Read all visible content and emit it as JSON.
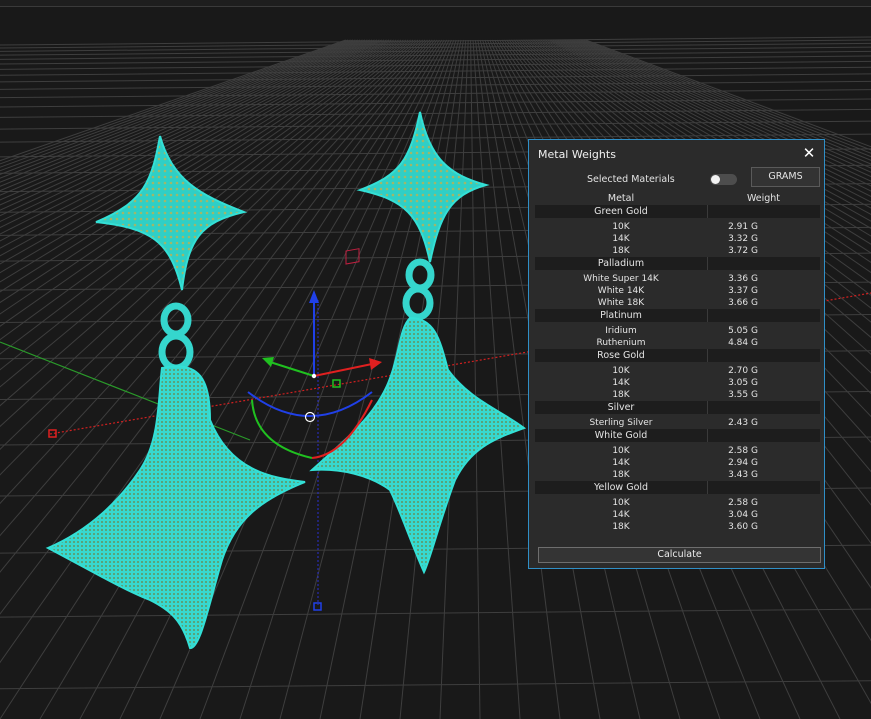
{
  "panel": {
    "title": "Metal Weights",
    "close_icon": "close-icon",
    "selected_materials_label": "Selected Materials",
    "selected_materials_on": false,
    "units_label": "GRAMS",
    "col_metal": "Metal",
    "col_weight": "Weight",
    "calculate_label": "Calculate",
    "accent_color": "#2f8fc7",
    "groups": [
      {
        "name": "Green Gold",
        "items": [
          {
            "name": "10K",
            "weight": "2.91 G"
          },
          {
            "name": "14K",
            "weight": "3.32 G"
          },
          {
            "name": "18K",
            "weight": "3.72 G"
          }
        ]
      },
      {
        "name": "Palladium",
        "items": [
          {
            "name": "White Super 14K",
            "weight": "3.36 G"
          },
          {
            "name": "White 14K",
            "weight": "3.37 G"
          },
          {
            "name": "White 18K",
            "weight": "3.66 G"
          }
        ]
      },
      {
        "name": "Platinum",
        "items": [
          {
            "name": "Iridium",
            "weight": "5.05 G"
          },
          {
            "name": "Ruthenium",
            "weight": "4.84 G"
          }
        ]
      },
      {
        "name": "Rose Gold",
        "items": [
          {
            "name": "10K",
            "weight": "2.70 G"
          },
          {
            "name": "14K",
            "weight": "3.05 G"
          },
          {
            "name": "18K",
            "weight": "3.55 G"
          }
        ]
      },
      {
        "name": "Silver",
        "items": [
          {
            "name": "Sterling Silver",
            "weight": "2.43 G"
          }
        ]
      },
      {
        "name": "White Gold",
        "items": [
          {
            "name": "10K",
            "weight": "2.58 G"
          },
          {
            "name": "14K",
            "weight": "2.94 G"
          },
          {
            "name": "18K",
            "weight": "3.43 G"
          }
        ]
      },
      {
        "name": "Yellow Gold",
        "items": [
          {
            "name": "10K",
            "weight": "2.58 G"
          },
          {
            "name": "14K",
            "weight": "3.04 G"
          },
          {
            "name": "18K",
            "weight": "3.60 G"
          }
        ]
      }
    ]
  },
  "viewport": {
    "model": "earrings-3d-model",
    "mesh_color": "#34d6cc",
    "grid_color": "#4a4a4a",
    "x_axis_color": "#e02020",
    "y_axis_color": "#30c030",
    "z_axis_color": "#2040e0"
  }
}
